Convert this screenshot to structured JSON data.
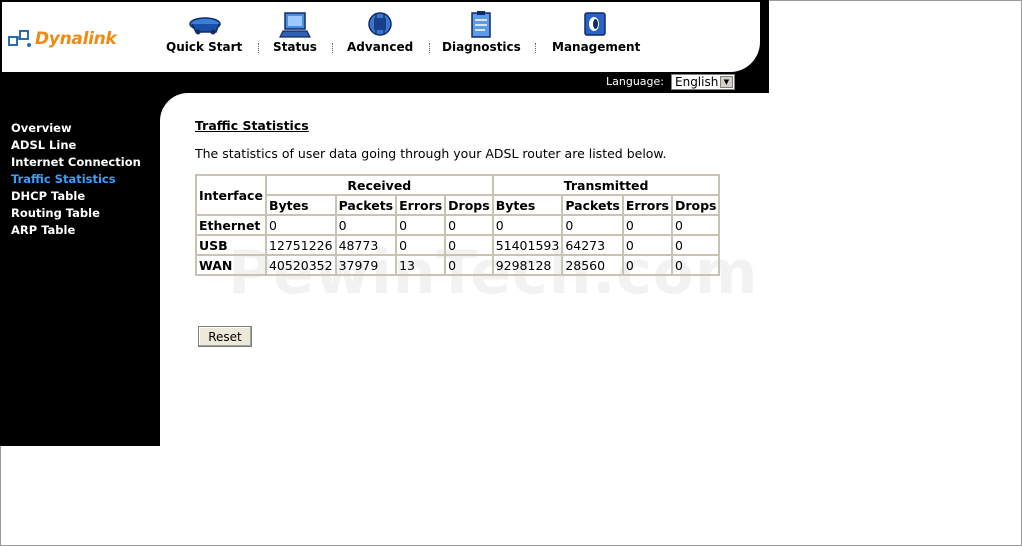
{
  "brand": {
    "name": "Dynalink"
  },
  "nav": {
    "items": [
      {
        "label": "Quick Start"
      },
      {
        "label": "Status"
      },
      {
        "label": "Advanced"
      },
      {
        "label": "Diagnostics"
      },
      {
        "label": "Management"
      }
    ]
  },
  "language": {
    "label": "Language:",
    "selected": "English"
  },
  "sidebar": {
    "items": [
      {
        "label": "Overview"
      },
      {
        "label": "ADSL Line"
      },
      {
        "label": "Internet Connection"
      },
      {
        "label": "Traffic Statistics",
        "active": true
      },
      {
        "label": "DHCP Table"
      },
      {
        "label": "Routing Table"
      },
      {
        "label": "ARP Table"
      }
    ]
  },
  "main": {
    "title": "Traffic Statistics",
    "description": "The statistics of user data going through your ADSL router are listed below.",
    "table": {
      "interface_header": "Interface",
      "received_header": "Received",
      "transmitted_header": "Transmitted",
      "sub_headers": [
        "Bytes",
        "Packets",
        "Errors",
        "Drops",
        "Bytes",
        "Packets",
        "Errors",
        "Drops"
      ],
      "rows": [
        {
          "interface": "Ethernet",
          "values": [
            "0",
            "0",
            "0",
            "0",
            "0",
            "0",
            "0",
            "0"
          ]
        },
        {
          "interface": "USB",
          "values": [
            "12751226",
            "48773",
            "0",
            "0",
            "51401593",
            "64273",
            "0",
            "0"
          ]
        },
        {
          "interface": "WAN",
          "values": [
            "40520352",
            "37979",
            "13",
            "0",
            "9298128",
            "28560",
            "0",
            "0"
          ]
        }
      ]
    },
    "reset_label": "Reset",
    "watermark": "PewinTech.com"
  }
}
